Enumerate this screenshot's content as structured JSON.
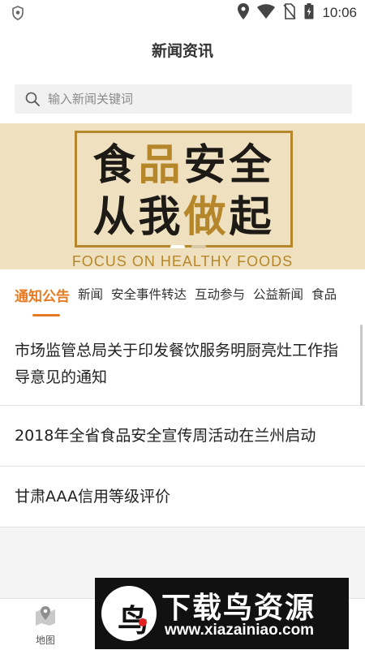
{
  "status_bar": {
    "time": "10:06",
    "icons": [
      "shield-icon",
      "location-icon",
      "wifi-icon",
      "no-sim-icon",
      "battery-icon"
    ]
  },
  "header": {
    "title": "新闻资讯"
  },
  "search": {
    "placeholder": "输入新闻关键词",
    "value": ""
  },
  "banner": {
    "line1_a": "食",
    "line1_accent": "品",
    "line1_b": "安全",
    "line2_a": "从我",
    "line2_accent": "做",
    "line2_b": "起",
    "subtitle": "FOCUS ON HEALTHY FOODS",
    "accent_color": "#b5872a"
  },
  "tabs": {
    "items": [
      "通知公告",
      "新闻",
      "安全事件转达",
      "互动参与",
      "公益新闻",
      "食品"
    ],
    "active": "通知公告",
    "active_color": "#e67a22"
  },
  "news": [
    {
      "title": "市场监管总局关于印发餐饮服务明厨亮灶工作指导意见的通知"
    },
    {
      "title": "2018年全省食品安全宣传周活动在兰州启动"
    },
    {
      "title": "甘肃AAA信用等级评价"
    }
  ],
  "bottom_nav": {
    "map_label": "地图"
  },
  "watermark": {
    "title": "下载鸟资源",
    "url": "www.xiazainiao.com"
  }
}
